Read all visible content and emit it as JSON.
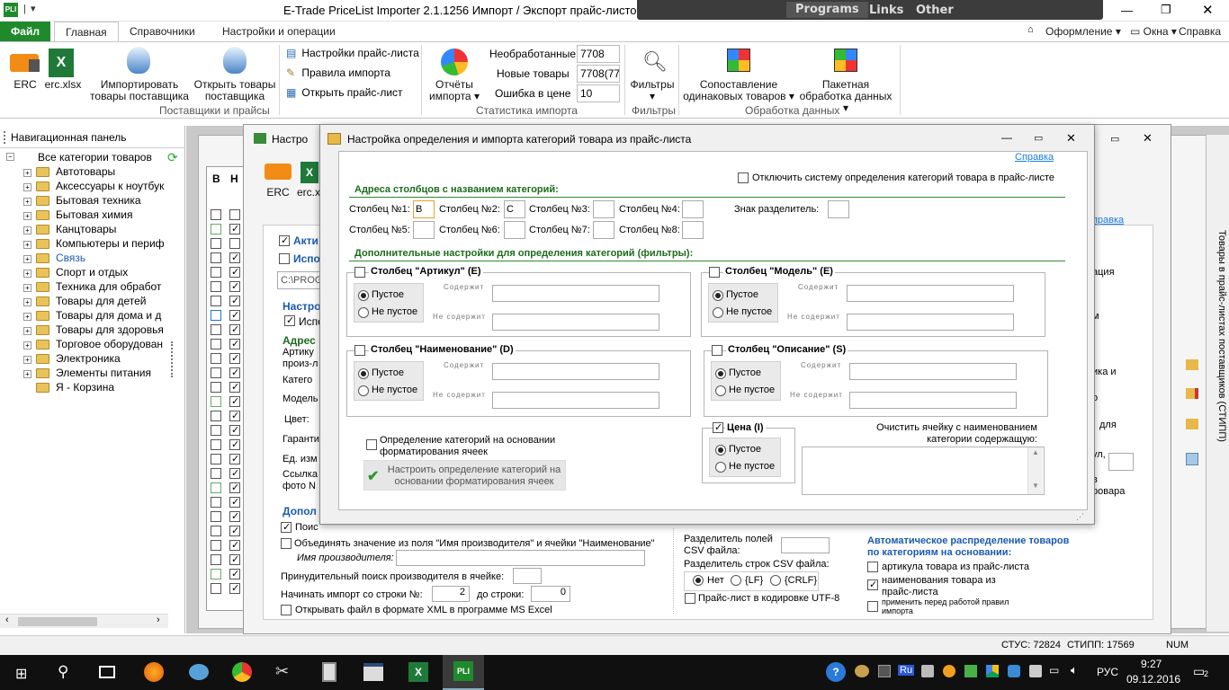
{
  "app": {
    "title": "E-Trade PriceList Importer 2.1.1256   Импорт / Экспорт прайс-листов по",
    "logo": "PLI"
  },
  "overlay": {
    "tabs": [
      "Programs",
      "Links",
      "Other"
    ]
  },
  "ribbon_tabs": {
    "file": "Файл",
    "tabs": [
      "Главная",
      "Справочники",
      "Настройки и операции"
    ],
    "right": [
      "Оформление",
      "Окна",
      "Справка"
    ]
  },
  "ribbon": {
    "erc": "ERC",
    "excel": "erc.xlsx",
    "import_goods": "Импортировать товары поставщика",
    "open_goods": "Открыть товары поставщика",
    "menu": [
      "Настройки прайс-листа",
      "Правила импорта",
      "Открыть прайс-лист"
    ],
    "group_suppliers": "Поставщики и прайсы",
    "reports": "Отчёты импорта",
    "stats": [
      {
        "label": "Необработанные",
        "value": "7708"
      },
      {
        "label": "Новые товары",
        "value": "7708(770"
      },
      {
        "label": "Ошибка в цене",
        "value": "10"
      }
    ],
    "group_stats": "Статистика импорта",
    "filters": "Фильтры",
    "group_filters": "Фильтры",
    "match": "Сопоставление одинаковых товаров",
    "batch": "Пакетная обработка данных",
    "group_processing": "Обработка данных"
  },
  "nav": {
    "title": "Навигационная панель",
    "root": "Все категории товаров",
    "items": [
      "Автотовары",
      "Аксессуары к ноутбук",
      "Бытовая техника",
      "Бытовая химия",
      "Канцтовары",
      "Компьютеры и периф",
      "Связь",
      "Спорт и отдых",
      "Техника для обработ",
      "Товары для детей",
      "Товары для дома и д",
      "Товары для здоровья",
      "Торговое оборудован",
      "Электроника",
      "Элементы питания",
      "Я - Корзина"
    ]
  },
  "grid": {
    "headers": [
      "В",
      "Н"
    ]
  },
  "win1": {
    "title": "Настро",
    "erc": "ERC",
    "excel": "erc.x",
    "labels": [
      "Акти",
      "Испо",
      "C:\\PROG",
      "Настро",
      "Испо",
      "Адрес",
      "Артику",
      "произ-л",
      "Катего",
      "Модель",
      "Цвет:",
      "Гаранти",
      "Ед. изм",
      "Ссылка",
      "фото N",
      "Допол"
    ],
    "bottom": {
      "search": "Поис",
      "combine": "Объединять значение из поля \"Имя производителя\" и ячейки \"Наименование\"",
      "manufacturer": "Имя производителя:",
      "force": "Принудительный поиск производителя в ячейке:",
      "start_row": "Начинать импорт со строки №:",
      "start_val": "2",
      "to_row": "до строки:",
      "to_val": "0",
      "open_xml": "Открывать файл в формате XML в программе MS Excel",
      "csv_sep": "Разделитель полей CSV файла:",
      "row_sep": "Разделитель строк CSV файла:",
      "opts": [
        "Нет",
        "{LF}",
        "{CRLF}"
      ],
      "utf8": "Прайс-лист в кодировке UTF-8",
      "auto": "Автоматическое распределение товаров по категориям на основании:",
      "auto_opts": [
        "артикула товара из прайс-листа",
        "наименования товара из прайс-листа",
        "применить перед работой правил импорта"
      ]
    },
    "right": [
      "Справка",
      "ация",
      "м",
      "ика и",
      "о",
      "для",
      "ул,",
      "в",
      "ровара"
    ]
  },
  "side_vertical": "Товары в прайс-листах поставщиков (СТИПП)",
  "dialog": {
    "title": "Настройка определения и импорта категорий товара из прайс-листа",
    "help": "Справка",
    "disable": "Отключить систему определения категорий товара в прайс-листе",
    "addr_title": "Адреса столбцов с названием категорий:",
    "cols": [
      {
        "label": "Столбец №1:",
        "value": "B"
      },
      {
        "label": "Столбец №2:",
        "value": "C"
      },
      {
        "label": "Столбец №3:",
        "value": ""
      },
      {
        "label": "Столбец №4:",
        "value": ""
      },
      {
        "label": "Столбец №5:",
        "value": ""
      },
      {
        "label": "Столбец №6:",
        "value": ""
      },
      {
        "label": "Столбец №7:",
        "value": ""
      },
      {
        "label": "Столбец №8:",
        "value": ""
      }
    ],
    "sep": "Знак разделитель:",
    "filters_title": "Дополнительные настройки для определения категорий (фильтры):",
    "groups": [
      {
        "title": "Столбец \"Артикул\" (E)"
      },
      {
        "title": "Столбец \"Модель\" (E)"
      },
      {
        "title": "Столбец \"Наименование\" (D)"
      },
      {
        "title": "Столбец \"Описание\" (S)"
      }
    ],
    "empty": "Пустое",
    "notempty": "Не пустое",
    "contains": "Содержит",
    "notcontains": "Не содержит",
    "format_cb": "Определение категорий на основании форматирования ячеек",
    "format_btn": "Настроить определение категорий на основании форматирования ячеек",
    "price": "Цена (I)",
    "clear": "Очистить ячейку с наименованием категории содержащую:"
  },
  "status": {
    "stus": "СТУС: 72824",
    "stipp": "СТИПП: 17569",
    "num": "NUM"
  },
  "taskbar": {
    "lang": "РУС",
    "time": "9:27",
    "date": "09.12.2016",
    "notif": "2"
  }
}
